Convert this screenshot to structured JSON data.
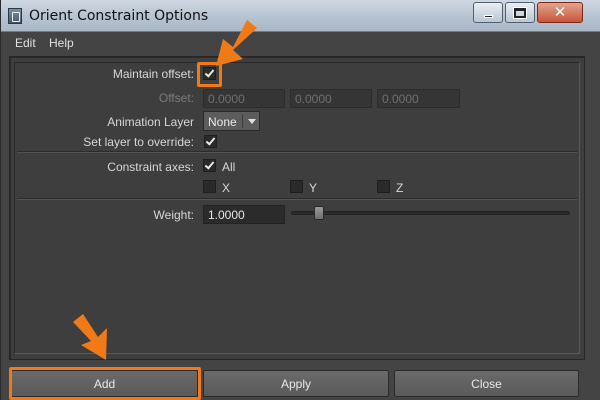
{
  "window": {
    "title": "Orient Constraint Options",
    "close_glyph": "✕"
  },
  "menu": {
    "items": [
      "Edit",
      "Help"
    ]
  },
  "options": {
    "maintain_offset": {
      "label": "Maintain offset:",
      "checked": true
    },
    "offset": {
      "label": "Offset:",
      "values": [
        "0.0000",
        "0.0000",
        "0.0000"
      ],
      "enabled": false
    },
    "animation_layer": {
      "label": "Animation Layer",
      "selected": "None"
    },
    "set_layer_override": {
      "label": "Set layer to override:",
      "checked": true
    },
    "constraint_axes": {
      "label": "Constraint axes:",
      "all": {
        "label": "All",
        "checked": true
      },
      "x": {
        "label": "X",
        "checked": false
      },
      "y": {
        "label": "Y",
        "checked": false
      },
      "z": {
        "label": "Z",
        "checked": false
      }
    },
    "weight": {
      "label": "Weight:",
      "value": "1.0000",
      "slider_fraction": 0.1
    }
  },
  "buttons": {
    "add": "Add",
    "apply": "Apply",
    "close": "Close"
  },
  "annotation": {
    "color": "#f07a17"
  }
}
